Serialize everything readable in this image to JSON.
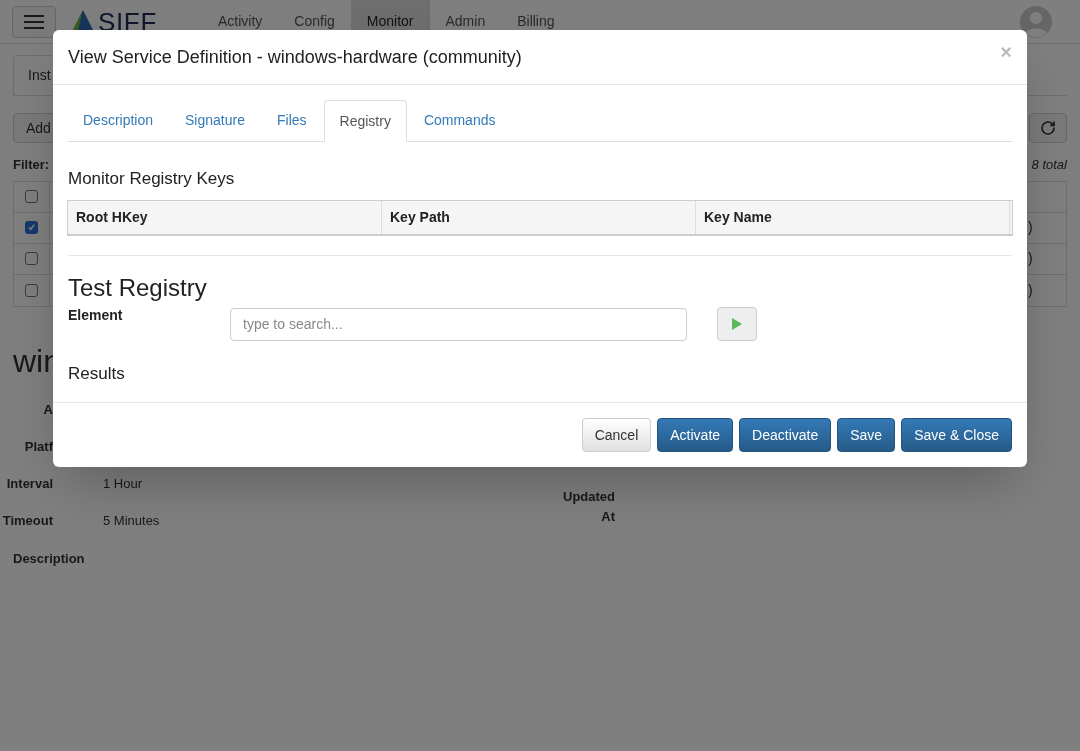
{
  "header": {
    "logo": "SIFF",
    "nav": [
      {
        "label": "Activity",
        "selected": false
      },
      {
        "label": "Config",
        "selected": false
      },
      {
        "label": "Monitor",
        "selected": true
      },
      {
        "label": "Admin",
        "selected": false
      },
      {
        "label": "Billing",
        "selected": false
      }
    ]
  },
  "page": {
    "tab": "Inst",
    "add_button": "Add",
    "filter_label": "Filter:",
    "total": "8 total",
    "rows": [
      {
        "checked": false
      },
      {
        "checked": true,
        "cell": ")"
      },
      {
        "checked": false,
        "cell": ")"
      },
      {
        "checked": false,
        "cell": ")"
      }
    ],
    "detail": {
      "title": "win",
      "fields": [
        {
          "label": "A"
        },
        {
          "label": "Platf"
        },
        {
          "label": "Interval",
          "value": "1 Hour"
        },
        {
          "label": "Timeout",
          "value": "5 Minutes"
        }
      ],
      "description_label": "Description",
      "updated_label": "Updated At"
    }
  },
  "modal": {
    "title": "View Service Definition - windows-hardware (community)",
    "close": "×",
    "tabs": [
      {
        "label": "Description",
        "selected": false
      },
      {
        "label": "Signature",
        "selected": false
      },
      {
        "label": "Files",
        "selected": false
      },
      {
        "label": "Registry",
        "selected": true
      },
      {
        "label": "Commands",
        "selected": false
      }
    ],
    "keys_title": "Monitor Registry Keys",
    "columns": [
      "Root HKey",
      "Key Path",
      "Key Name"
    ],
    "test_title": "Test Registry",
    "element_label": "Element",
    "search": {
      "placeholder": "type to search..."
    },
    "results_label": "Results",
    "buttons": [
      {
        "label": "Cancel",
        "kind": "default"
      },
      {
        "label": "Activate",
        "kind": "primary"
      },
      {
        "label": "Deactivate",
        "kind": "primary"
      },
      {
        "label": "Save",
        "kind": "primary"
      },
      {
        "label": "Save & Close",
        "kind": "primary"
      }
    ]
  }
}
